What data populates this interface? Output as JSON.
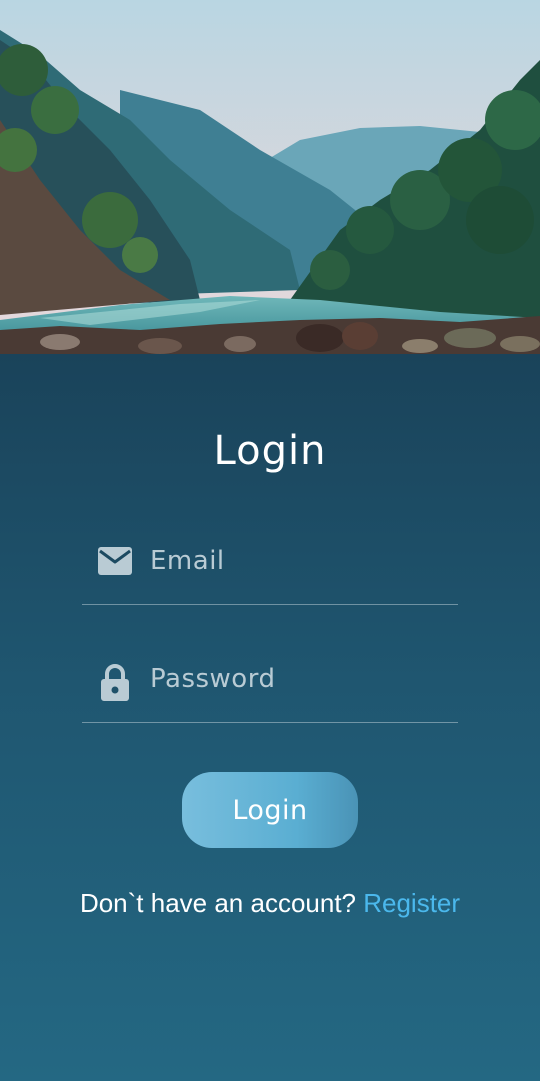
{
  "hero": {
    "description_icon": "mountain-river-photo"
  },
  "login": {
    "title": "Login",
    "email": {
      "placeholder": "Email",
      "value": "",
      "icon": "mail-icon"
    },
    "password": {
      "placeholder": "Password",
      "value": "",
      "icon": "lock-icon"
    },
    "button_label": "Login",
    "prompt_text": "Don`t have an account?",
    "register_link": "Register"
  },
  "colors": {
    "panel_top": "#1a435a",
    "panel_bottom": "#246883",
    "button": "#5aaed2",
    "link": "#4bb8ec",
    "icon": "#b9cbd4"
  }
}
